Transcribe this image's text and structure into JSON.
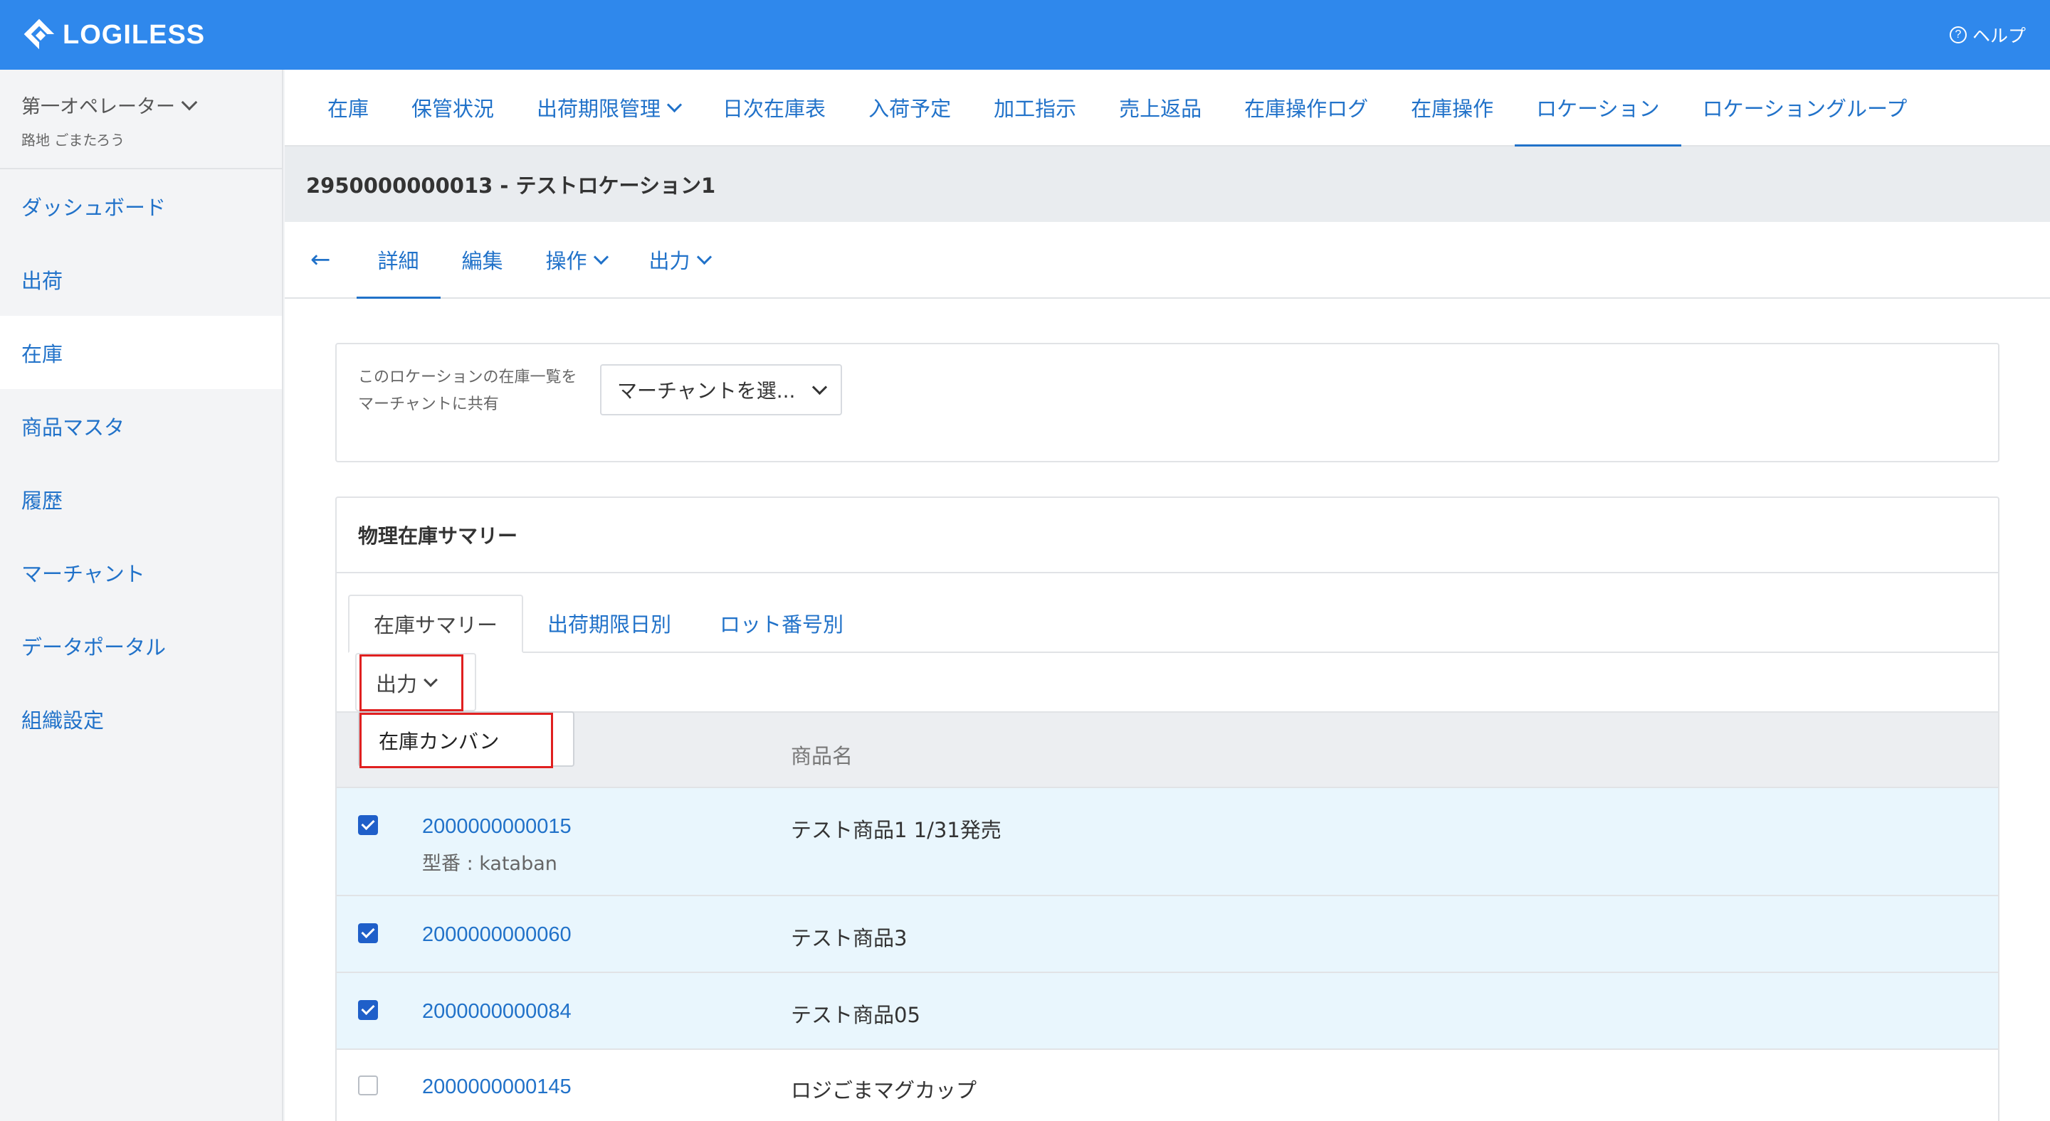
{
  "topbar": {
    "brand": "LOGILESS",
    "help_label": "ヘルプ",
    "help_icon_glyph": "?"
  },
  "sidebar": {
    "user_name": "第一オペレーター",
    "user_sub": "路地 ごまたろう",
    "items": [
      {
        "label": "ダッシュボード"
      },
      {
        "label": "出荷"
      },
      {
        "label": "在庫"
      },
      {
        "label": "商品マスタ"
      },
      {
        "label": "履歴"
      },
      {
        "label": "マーチャント"
      },
      {
        "label": "データポータル"
      },
      {
        "label": "組織設定"
      }
    ],
    "active_index": 2
  },
  "tabs": [
    {
      "label": "在庫"
    },
    {
      "label": "保管状況"
    },
    {
      "label": "出荷期限管理"
    },
    {
      "label": "日次在庫表"
    },
    {
      "label": "入荷予定"
    },
    {
      "label": "加工指示"
    },
    {
      "label": "売上返品"
    },
    {
      "label": "在庫操作ログ"
    },
    {
      "label": "在庫操作"
    },
    {
      "label": "ロケーション"
    },
    {
      "label": "ロケーショングループ"
    }
  ],
  "location_title": "2950000000013 - テストロケーション1",
  "subtabs": {
    "back": "←",
    "detail": "詳細",
    "edit": "編集",
    "operation": "操作",
    "output": "出力"
  },
  "share": {
    "label_line1": "このロケーションの在庫一覧を",
    "label_line2": "マーチャントに共有",
    "select_value": "マーチャントを選..."
  },
  "summary": {
    "title": "物理在庫サマリー",
    "tabs": [
      "在庫サマリー",
      "出荷期限日別",
      "ロット番号別"
    ],
    "output_button": "出力",
    "dropdown_item": "在庫カンバン",
    "column_product_name": "商品名",
    "rows": [
      {
        "code": "2000000000015",
        "sub": "型番 : kataban",
        "name": "テスト商品1 1/31発売",
        "checked": true
      },
      {
        "code": "2000000000060",
        "sub": "",
        "name": "テスト商品3",
        "checked": true
      },
      {
        "code": "2000000000084",
        "sub": "",
        "name": "テスト商品05",
        "checked": true
      },
      {
        "code": "2000000000145",
        "sub": "",
        "name": "ロジごまマグカップ",
        "checked": false
      }
    ]
  },
  "colors": {
    "brand": "#2f88ec",
    "link": "#2172c9",
    "highlight": "#e02020",
    "selected_row": "#e9f6fd"
  }
}
